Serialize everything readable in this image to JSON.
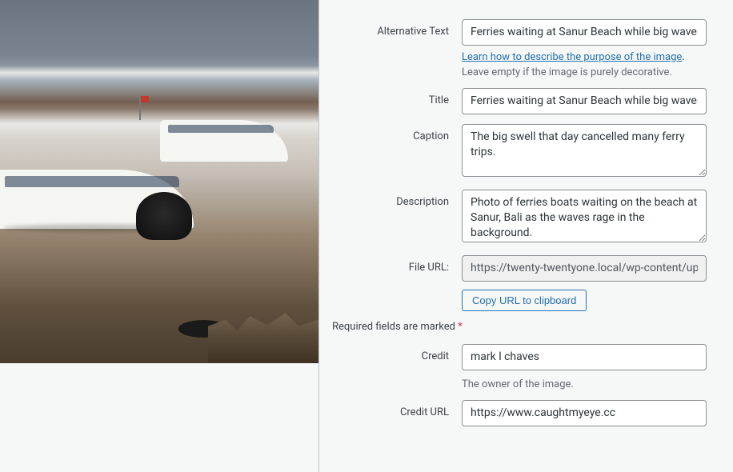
{
  "labels": {
    "alt_text": "Alternative Text",
    "title": "Title",
    "caption": "Caption",
    "description": "Description",
    "file_url": "File URL:",
    "credit": "Credit",
    "credit_url": "Credit URL"
  },
  "values": {
    "alt_text": "Ferries waiting at Sanur Beach while big waves crash",
    "title": "Ferries waiting at Sanur Beach while big waves crash",
    "caption": "The big swell that day cancelled many ferry trips.",
    "description": "Photo of ferries boats waiting on the beach at Sanur, Bali as the waves rage in the background.",
    "file_url": "https://twenty-twentyone.local/wp-content/uploads/...",
    "credit": "mark l chaves",
    "credit_url": "https://www.caughtmyeye.cc"
  },
  "alt_help": {
    "link_text": "Learn how to describe the purpose of the image",
    "period": ".",
    "empty_hint": "Leave empty if the image is purely decorative."
  },
  "copy_button": "Copy URL to clipboard",
  "required_note": "Required fields are marked ",
  "credit_help": "The owner of the image."
}
